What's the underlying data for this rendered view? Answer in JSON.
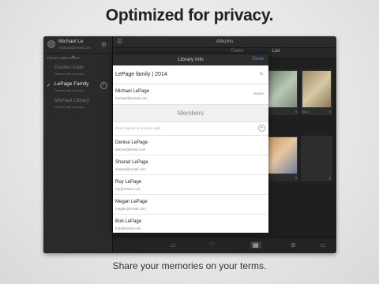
{
  "headline": "Optimized for privacy.",
  "caption": "Share your memories on your terms.",
  "sidebar": {
    "profile_name": "Michael Le",
    "profile_email": "michael@email.com",
    "section_header": "YOUR LIBRARIES",
    "add_label": "+",
    "libraries": [
      {
        "name": "Golden Gate",
        "sub": "Owned with 4 people",
        "state": "dim"
      },
      {
        "name": "LePage Family",
        "sub": "Owned with 5 people",
        "state": "selected"
      },
      {
        "name": "Michael Library",
        "sub": "Owned with 3 people",
        "state": "dim"
      }
    ]
  },
  "topbar": {
    "title": "Albums"
  },
  "tabs": {
    "dates": "Dates",
    "list": "List"
  },
  "thumbs": [
    {
      "meta": "6",
      "count": "6"
    },
    {
      "meta": "Nov 6",
      "count": "6"
    },
    {
      "meta": "6",
      "count": "6"
    },
    {
      "meta": "",
      "count": "6"
    }
  ],
  "modal": {
    "title": "Library Info",
    "done": "Done",
    "library_name": "LePage family | 2014",
    "owner": {
      "name": "Michael LePage",
      "email": "michael@email.com",
      "tag": "Owner"
    },
    "members_title": "Members",
    "invite_placeholder": "Enter names or email to add",
    "invite_add": "+",
    "members": [
      {
        "name": "Denise LePage",
        "email": "denise@email.com"
      },
      {
        "name": "Sharad LePage",
        "email": "sharad@email.com"
      },
      {
        "name": "Roy LePage",
        "email": "roy@email.com"
      },
      {
        "name": "Megan LePage",
        "email": "megan@email.com"
      },
      {
        "name": "Bob LePage",
        "email": "bob@email.com"
      }
    ]
  },
  "icons": {
    "gear": "⚙",
    "menu": "☰",
    "check": "✓",
    "info": "i",
    "edit": "✎",
    "bottom": [
      "▭",
      "♡",
      "▤",
      "⊘",
      "▭"
    ]
  },
  "colors": {
    "accent": "#4a90d9",
    "panel_dark": "#2d2d2d"
  }
}
